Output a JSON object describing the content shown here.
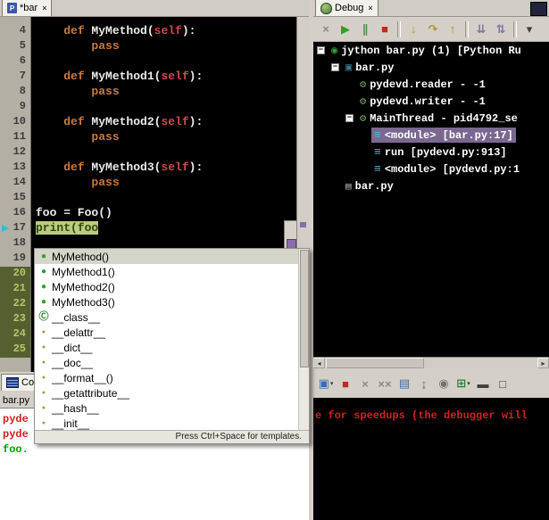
{
  "colors": {
    "chrome": "#d4d0c8",
    "editor_bg": "#000000",
    "keyword": "#c87a3c",
    "self_arg": "#cc4b4b",
    "code_text": "#ececec",
    "highlight_bg": "#bccb7c",
    "highlight_text": "#2d4a0d",
    "selection_purple": "#7a6890",
    "console_red": "#d42020",
    "console_green": "#00a000"
  },
  "icon_defs": {
    "method": {
      "glyph": "●",
      "color": "#2f9e2f",
      "size": 10
    },
    "class": {
      "glyph": "Ⓒ",
      "color": "#2e8e2e",
      "size": 11
    },
    "attr": {
      "glyph": "●",
      "color": "#9aa050",
      "size": 7
    },
    "launch": {
      "glyph": "◉",
      "color": "#35a035",
      "size": 12
    },
    "process": {
      "glyph": "▣",
      "color": "#3a7a8a",
      "size": 12
    },
    "thread": {
      "glyph": "⚙",
      "color": "#7aa06a",
      "size": 12
    },
    "frame": {
      "glyph": "≡",
      "color": "#5ab4d6",
      "size": 13
    },
    "file": {
      "glyph": "▤",
      "color": "#a8a8a8",
      "size": 11
    }
  },
  "editor": {
    "tab": {
      "label": "*bar",
      "close": "×"
    },
    "gutter": [
      {
        "n": "4",
        "style": "plain"
      },
      {
        "n": "5",
        "style": "plain"
      },
      {
        "n": "6",
        "style": "plain"
      },
      {
        "n": "7",
        "style": "plain"
      },
      {
        "n": "8",
        "style": "plain"
      },
      {
        "n": "9",
        "style": "plain"
      },
      {
        "n": "10",
        "style": "plain"
      },
      {
        "n": "11",
        "style": "plain"
      },
      {
        "n": "12",
        "style": "plain"
      },
      {
        "n": "13",
        "style": "plain"
      },
      {
        "n": "14",
        "style": "plain"
      },
      {
        "n": "15",
        "style": "plain"
      },
      {
        "n": "16",
        "style": "plain"
      },
      {
        "n": "17",
        "style": "plain"
      },
      {
        "n": "18",
        "style": "plain"
      },
      {
        "n": "19",
        "style": "plain"
      },
      {
        "n": "20",
        "style": "added"
      },
      {
        "n": "21",
        "style": "added"
      },
      {
        "n": "22",
        "style": "added"
      },
      {
        "n": "23",
        "style": "added"
      },
      {
        "n": "24",
        "style": "added"
      },
      {
        "n": "25",
        "style": "added"
      }
    ],
    "lines": [
      {
        "n": 4,
        "segs": [
          {
            "t": "    "
          },
          {
            "t": "def",
            "c": "kw"
          },
          {
            "t": " MyMethod("
          },
          {
            "t": "self",
            "c": "self"
          },
          {
            "t": "):"
          }
        ]
      },
      {
        "n": 5,
        "segs": [
          {
            "t": "        "
          },
          {
            "t": "pass",
            "c": "kw"
          }
        ]
      },
      {
        "n": 6,
        "segs": []
      },
      {
        "n": 7,
        "segs": [
          {
            "t": "    "
          },
          {
            "t": "def",
            "c": "kw"
          },
          {
            "t": " MyMethod1("
          },
          {
            "t": "self",
            "c": "self"
          },
          {
            "t": "):"
          }
        ]
      },
      {
        "n": 8,
        "segs": [
          {
            "t": "        "
          },
          {
            "t": "pass",
            "c": "kw"
          }
        ]
      },
      {
        "n": 9,
        "segs": []
      },
      {
        "n": 10,
        "segs": [
          {
            "t": "    "
          },
          {
            "t": "def",
            "c": "kw"
          },
          {
            "t": " MyMethod2("
          },
          {
            "t": "self",
            "c": "self"
          },
          {
            "t": "):"
          }
        ]
      },
      {
        "n": 11,
        "segs": [
          {
            "t": "        "
          },
          {
            "t": "pass",
            "c": "kw"
          }
        ]
      },
      {
        "n": 12,
        "segs": []
      },
      {
        "n": 13,
        "segs": [
          {
            "t": "    "
          },
          {
            "t": "def",
            "c": "kw"
          },
          {
            "t": " MyMethod3("
          },
          {
            "t": "self",
            "c": "self"
          },
          {
            "t": "):"
          }
        ]
      },
      {
        "n": 14,
        "segs": [
          {
            "t": "        "
          },
          {
            "t": "pass",
            "c": "kw"
          }
        ]
      },
      {
        "n": 15,
        "segs": []
      },
      {
        "n": 16,
        "segs": [
          {
            "t": "foo = Foo()"
          }
        ]
      },
      {
        "n": 17,
        "segs": [
          {
            "t": "print(foo",
            "c": "hl"
          }
        ]
      }
    ]
  },
  "completion": {
    "items": [
      {
        "icon": "method",
        "label": "MyMethod()",
        "selected": true
      },
      {
        "icon": "method",
        "label": "MyMethod1()"
      },
      {
        "icon": "method",
        "label": "MyMethod2()"
      },
      {
        "icon": "method",
        "label": "MyMethod3()"
      },
      {
        "icon": "class",
        "label": "__class__"
      },
      {
        "icon": "attr",
        "label": "__delattr__"
      },
      {
        "icon": "attr",
        "label": "__dict__"
      },
      {
        "icon": "attr",
        "label": "__doc__"
      },
      {
        "icon": "attr",
        "label": "__format__()"
      },
      {
        "icon": "attr",
        "label": "__getattribute__"
      },
      {
        "icon": "attr",
        "label": "__hash__"
      },
      {
        "icon": "attr",
        "label": "__init__"
      }
    ],
    "hint": "Press Ctrl+Space for templates."
  },
  "debug": {
    "tab": {
      "label": "Debug",
      "close": "×"
    },
    "toolbar": [
      {
        "name": "remove-all-terminated-button",
        "glyph": "×",
        "color": "#8a8a8a"
      },
      {
        "name": "resume-button",
        "glyph": "▶",
        "color": "#2e9e2e"
      },
      {
        "name": "suspend-button",
        "glyph": "∥",
        "color": "#4d8a4d"
      },
      {
        "name": "terminate-button",
        "glyph": "■",
        "color": "#c4281e"
      },
      {
        "name": "separator"
      },
      {
        "name": "step-into-button",
        "glyph": "↓",
        "color": "#b8932a"
      },
      {
        "name": "step-over-button",
        "glyph": "↷",
        "color": "#b8932a"
      },
      {
        "name": "step-return-button",
        "glyph": "↑",
        "color": "#b8932a"
      },
      {
        "name": "separator"
      },
      {
        "name": "drop-to-frame-button",
        "glyph": "⇊",
        "color": "#7a7aa0"
      },
      {
        "name": "use-step-filters-button",
        "glyph": "⇅",
        "color": "#7a7aa0"
      },
      {
        "name": "separator"
      },
      {
        "name": "view-menu-button",
        "glyph": "▾",
        "color": "#404040"
      }
    ],
    "tree": [
      {
        "level": 0,
        "expand": true,
        "icon": "launch",
        "label": "jython bar.py (1) [Python Ru"
      },
      {
        "level": 1,
        "expand": true,
        "icon": "process",
        "label": "bar.py"
      },
      {
        "level": 2,
        "expand": null,
        "icon": "thread",
        "label": "pydevd.reader - -1"
      },
      {
        "level": 2,
        "expand": null,
        "icon": "thread",
        "label": "pydevd.writer - -1"
      },
      {
        "level": 2,
        "expand": true,
        "icon": "thread",
        "label": "MainThread - pid4792_se"
      },
      {
        "level": 3,
        "expand": null,
        "icon": "frame",
        "label": "<module> [bar.py:17]",
        "selected": true
      },
      {
        "level": 3,
        "expand": null,
        "icon": "frame",
        "label": "run [pydevd.py:913]"
      },
      {
        "level": 3,
        "expand": null,
        "icon": "frame",
        "label": "<module> [pydevd.py:1"
      },
      {
        "level": 1,
        "expand": null,
        "icon": "file",
        "label": "bar.py"
      }
    ],
    "hscroll": {
      "left_arrow": "◂",
      "right_arrow": "▸"
    }
  },
  "console_left": {
    "tab": {
      "label": "Co"
    },
    "title": "bar.py",
    "lines": [
      {
        "text": "pyde",
        "color": "#d42020"
      },
      {
        "text": "pyde",
        "color": "#d42020"
      },
      {
        "text": "foo.",
        "color": "#00a000"
      }
    ]
  },
  "bottom_right": {
    "toolbar": [
      {
        "name": "display-console-button",
        "glyph": "▣",
        "color": "#3a6ab0",
        "caret": true
      },
      {
        "name": "terminate-button",
        "glyph": "■",
        "color": "#c4281e"
      },
      {
        "name": "remove-launch-button",
        "glyph": "×",
        "color": "#8a8a8a"
      },
      {
        "name": "remove-all-terminated-button",
        "glyph": "××",
        "color": "#8a8a8a"
      },
      {
        "name": "clear-console-button",
        "glyph": "▤",
        "color": "#4a6a9a"
      },
      {
        "name": "scroll-lock-button",
        "glyph": "↨",
        "color": "#707070"
      },
      {
        "name": "pin-console-button",
        "glyph": "◉",
        "color": "#707070"
      },
      {
        "name": "open-console-button",
        "glyph": "⊞",
        "color": "#2e7e2e",
        "caret": true
      },
      {
        "name": "minimize-button",
        "glyph": "▬",
        "color": "#404040"
      },
      {
        "name": "maximize-button",
        "glyph": "□",
        "color": "#404040"
      }
    ],
    "lines": [
      {
        "text": "e for speedups (the debugger will",
        "color": "#d42020"
      }
    ]
  }
}
